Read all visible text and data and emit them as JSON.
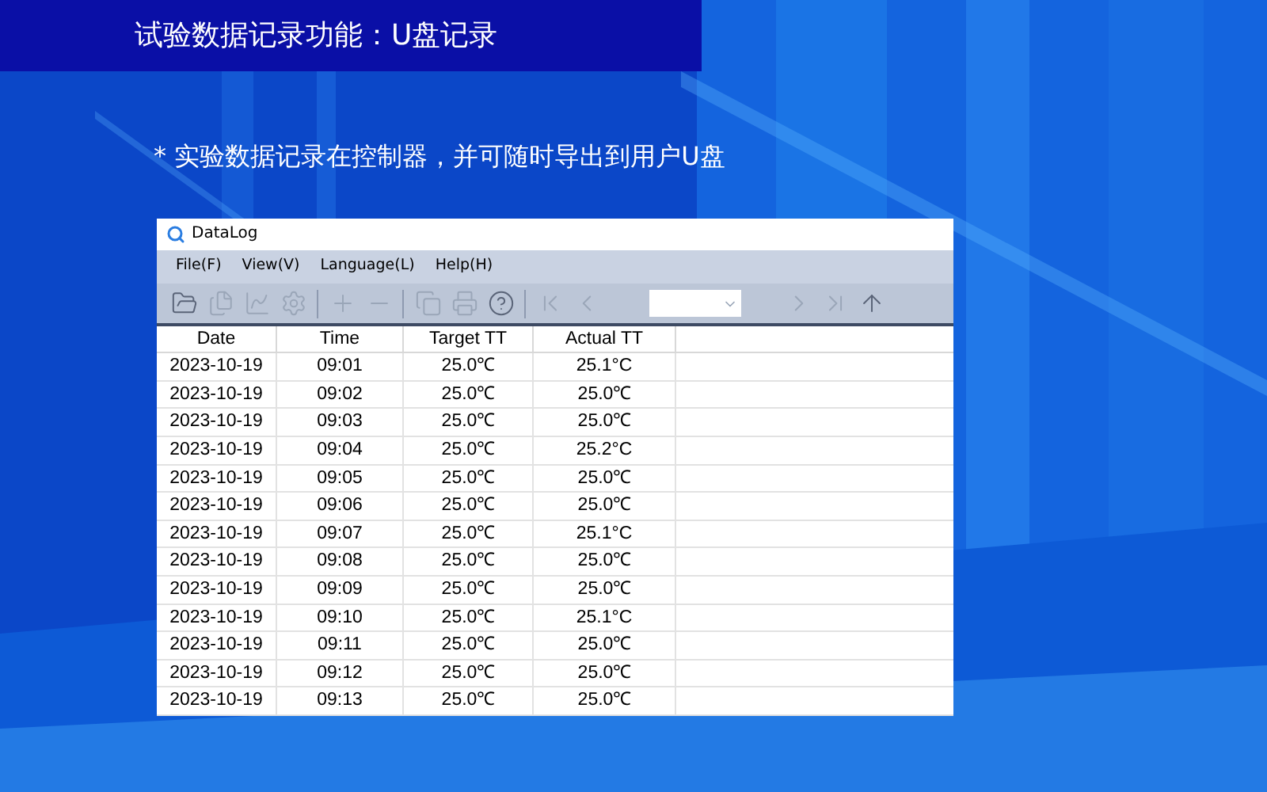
{
  "slide": {
    "title": "试验数据记录功能：U盘记录",
    "note": "* 实验数据记录在控制器，并可随时导出到用户U盘"
  },
  "window": {
    "title": "DataLog"
  },
  "menu": [
    "File(F)",
    "View(V)",
    "Language(L)",
    "Help(H)"
  ],
  "table": {
    "columns": [
      "Date",
      "Time",
      "Target TT",
      "Actual TT"
    ],
    "rows": [
      [
        "2023-10-19",
        "09:01",
        "25.0℃",
        "25.1°C"
      ],
      [
        "2023-10-19",
        "09:02",
        "25.0℃",
        "25.0℃"
      ],
      [
        "2023-10-19",
        "09:03",
        "25.0℃",
        "25.0℃"
      ],
      [
        "2023-10-19",
        "09:04",
        "25.0℃",
        "25.2°C"
      ],
      [
        "2023-10-19",
        "09:05",
        "25.0℃",
        "25.0℃"
      ],
      [
        "2023-10-19",
        "09:06",
        "25.0℃",
        "25.0℃"
      ],
      [
        "2023-10-19",
        "09:07",
        "25.0℃",
        "25.1°C"
      ],
      [
        "2023-10-19",
        "09:08",
        "25.0℃",
        "25.0℃"
      ],
      [
        "2023-10-19",
        "09:09",
        "25.0℃",
        "25.0℃"
      ],
      [
        "2023-10-19",
        "09:10",
        "25.0℃",
        "25.1°C"
      ],
      [
        "2023-10-19",
        "09:11",
        "25.0℃",
        "25.0℃"
      ],
      [
        "2023-10-19",
        "09:12",
        "25.0℃",
        "25.0℃"
      ],
      [
        "2023-10-19",
        "09:13",
        "25.0℃",
        "25.0℃"
      ]
    ]
  }
}
